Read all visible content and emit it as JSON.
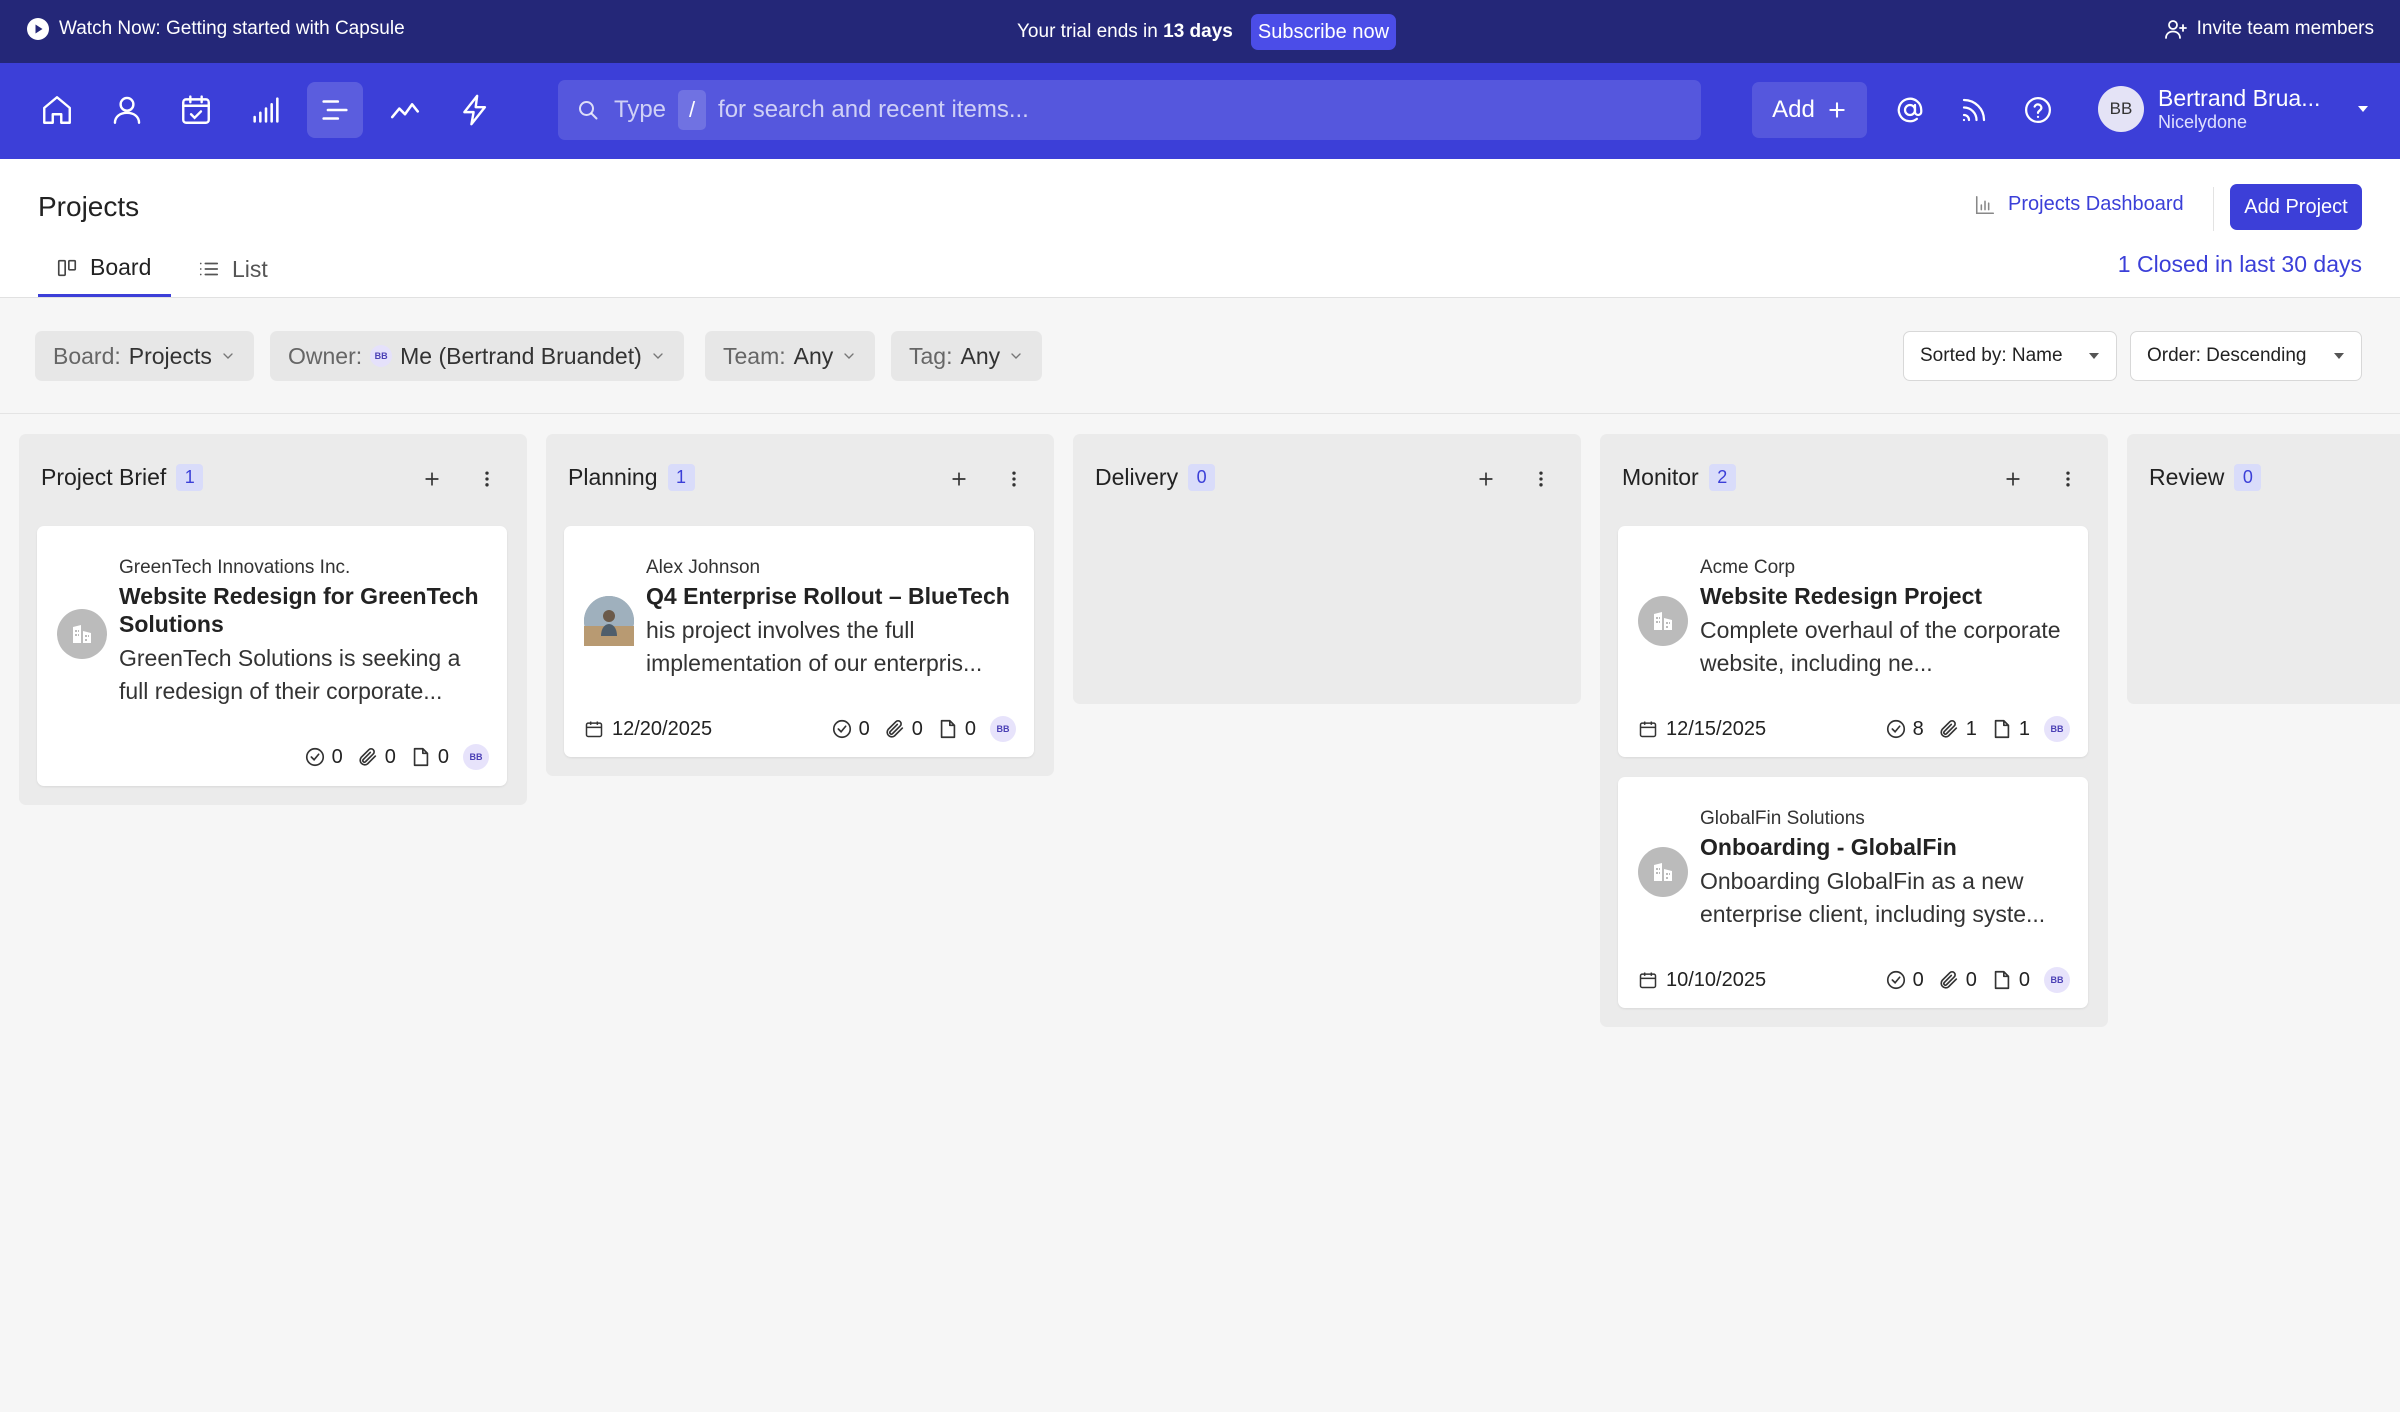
{
  "promo": {
    "watch_label": "Watch Now: Getting started with Capsule",
    "trial_prefix": "Your trial ends in",
    "trial_days": "13 days",
    "subscribe_label": "Subscribe now",
    "invite_label": "Invite team members"
  },
  "nav": {
    "search_type": "Type",
    "search_key": "/",
    "search_placeholder": "for search and recent items...",
    "add_label": "Add",
    "user": {
      "initials": "BB",
      "name": "Bertrand Brua...",
      "org": "Nicelydone"
    }
  },
  "header": {
    "title": "Projects",
    "dashboard_link": "Projects Dashboard",
    "add_project": "Add Project",
    "tabs": [
      {
        "label": "Board"
      },
      {
        "label": "List"
      }
    ],
    "closed_link": "1 Closed in last 30 days"
  },
  "filters": {
    "board": {
      "label": "Board:",
      "value": "Projects"
    },
    "owner": {
      "label": "Owner:",
      "avatar": "BB",
      "value": "Me (Bertrand Bruandet)"
    },
    "team": {
      "label": "Team:",
      "value": "Any"
    },
    "tag": {
      "label": "Tag:",
      "value": "Any"
    },
    "sort": "Sorted by: Name",
    "order": "Order: Descending"
  },
  "columns": [
    {
      "title": "Project Brief",
      "count": "1",
      "cards": [
        {
          "org": "GreenTech Innovations Inc.",
          "name": "Website Redesign for GreenTech Solutions",
          "desc": "GreenTech Solutions is seeking a full redesign of their corporate...",
          "date": "",
          "tasks": "0",
          "attachments": "0",
          "files": "0",
          "owner": "BB"
        }
      ]
    },
    {
      "title": "Planning",
      "count": "1",
      "cards": [
        {
          "org": "Alex Johnson",
          "name": "Q4 Enterprise Rollout – BlueTech",
          "desc": "his project involves the full implementation of our enterpris...",
          "date": "12/20/2025",
          "tasks": "0",
          "attachments": "0",
          "files": "0",
          "owner": "BB"
        }
      ]
    },
    {
      "title": "Delivery",
      "count": "0",
      "cards": []
    },
    {
      "title": "Monitor",
      "count": "2",
      "cards": [
        {
          "org": "Acme Corp",
          "name": "Website Redesign Project",
          "desc": "Complete overhaul of the corporate website, including ne...",
          "date": "12/15/2025",
          "tasks": "8",
          "attachments": "1",
          "files": "1",
          "owner": "BB"
        },
        {
          "org": "GlobalFin Solutions",
          "name": "Onboarding - GlobalFin",
          "desc": "Onboarding GlobalFin as a new enterprise client, including syste...",
          "date": "10/10/2025",
          "tasks": "0",
          "attachments": "0",
          "files": "0",
          "owner": "BB"
        }
      ]
    },
    {
      "title": "Review",
      "count": "0",
      "cards": []
    }
  ],
  "colors": {
    "brand": "#3c3fd8",
    "promo_bg": "#242778",
    "badge_bg": "#d9dcfa"
  }
}
